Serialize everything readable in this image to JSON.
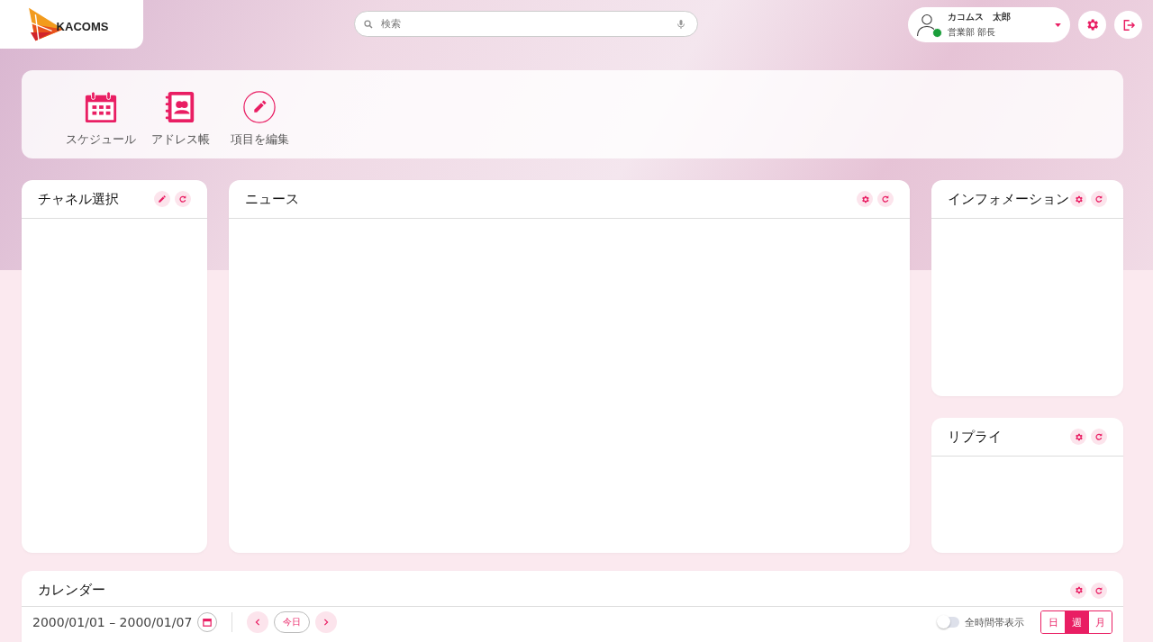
{
  "logo": {
    "text": "KACOMS"
  },
  "search": {
    "placeholder": "検索"
  },
  "user": {
    "name": "カコムス　太郎",
    "title": "営業部 部長",
    "online": true
  },
  "shortcuts": [
    {
      "kind": "calendar",
      "label": "スケジュール"
    },
    {
      "kind": "address-book",
      "label": "アドレス帳"
    },
    {
      "kind": "edit",
      "label": "項目を編集"
    }
  ],
  "widgets": [
    {
      "title": "チャネル選択",
      "kind": "edit"
    },
    {
      "title": "ニュース",
      "kind": "settings"
    },
    {
      "title": "インフォメーション",
      "kind": "settings"
    },
    {
      "title": "リプライ",
      "kind": "settings"
    }
  ],
  "calendar": {
    "title": "カレンダー",
    "kind": "settings",
    "range": "2000/01/01 – 2000/01/07",
    "today": "今日",
    "all_day_toggle": {
      "label": "全時間帯表示",
      "on": false
    },
    "views": [
      {
        "label": "日",
        "selected": false
      },
      {
        "label": "週",
        "selected": true
      },
      {
        "label": "月",
        "selected": false
      }
    ]
  }
}
